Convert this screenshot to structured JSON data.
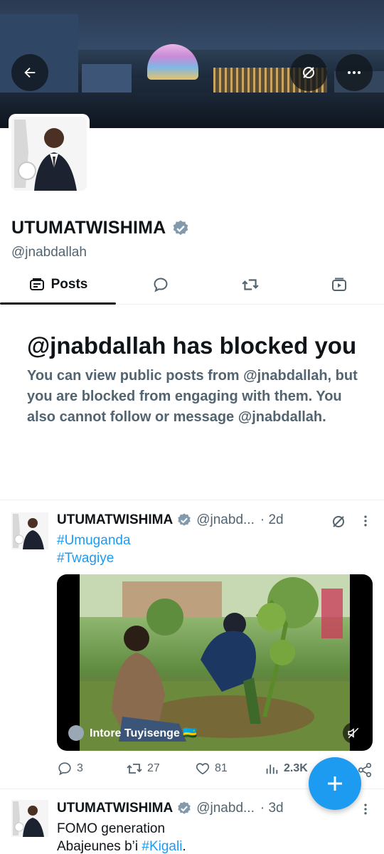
{
  "profile": {
    "display_name": "UTUMATWISHIMA",
    "handle": "@jnabdallah"
  },
  "tabs": [
    {
      "label": "Posts",
      "icon": "posts-icon",
      "active": true
    },
    {
      "label": "",
      "icon": "replies-icon",
      "active": false
    },
    {
      "label": "",
      "icon": "reposts-icon",
      "active": false
    },
    {
      "label": "",
      "icon": "media-icon",
      "active": false
    }
  ],
  "block_notice": {
    "title": "@jnabdallah has blocked you",
    "text": "You can view public posts from @jnabdallah, but you are blocked from engaging with them. You also cannot follow or message @jnabdallah."
  },
  "tweets": [
    {
      "name": "UTUMATWISHIMA",
      "handle": "@jnabd...",
      "time": "· 2d",
      "lines": [
        "#Umuganda",
        "#Twagiye"
      ],
      "media_label": "Intore Tuyisenge 🇷🇼",
      "replies": "3",
      "reposts": "27",
      "likes": "81",
      "views": "2.3K"
    },
    {
      "name": "UTUMATWISHIMA",
      "handle": "@jnabd...",
      "time": "· 3d",
      "line1": "FOMO generation",
      "line2_prefix": "Abajeunes b’i ",
      "line2_tag": "#Kigali",
      "line2_suffix": "."
    }
  ],
  "colors": {
    "accent": "#1d9bf0",
    "text": "#0f1419",
    "muted": "#536471",
    "verified": "#829aab"
  }
}
